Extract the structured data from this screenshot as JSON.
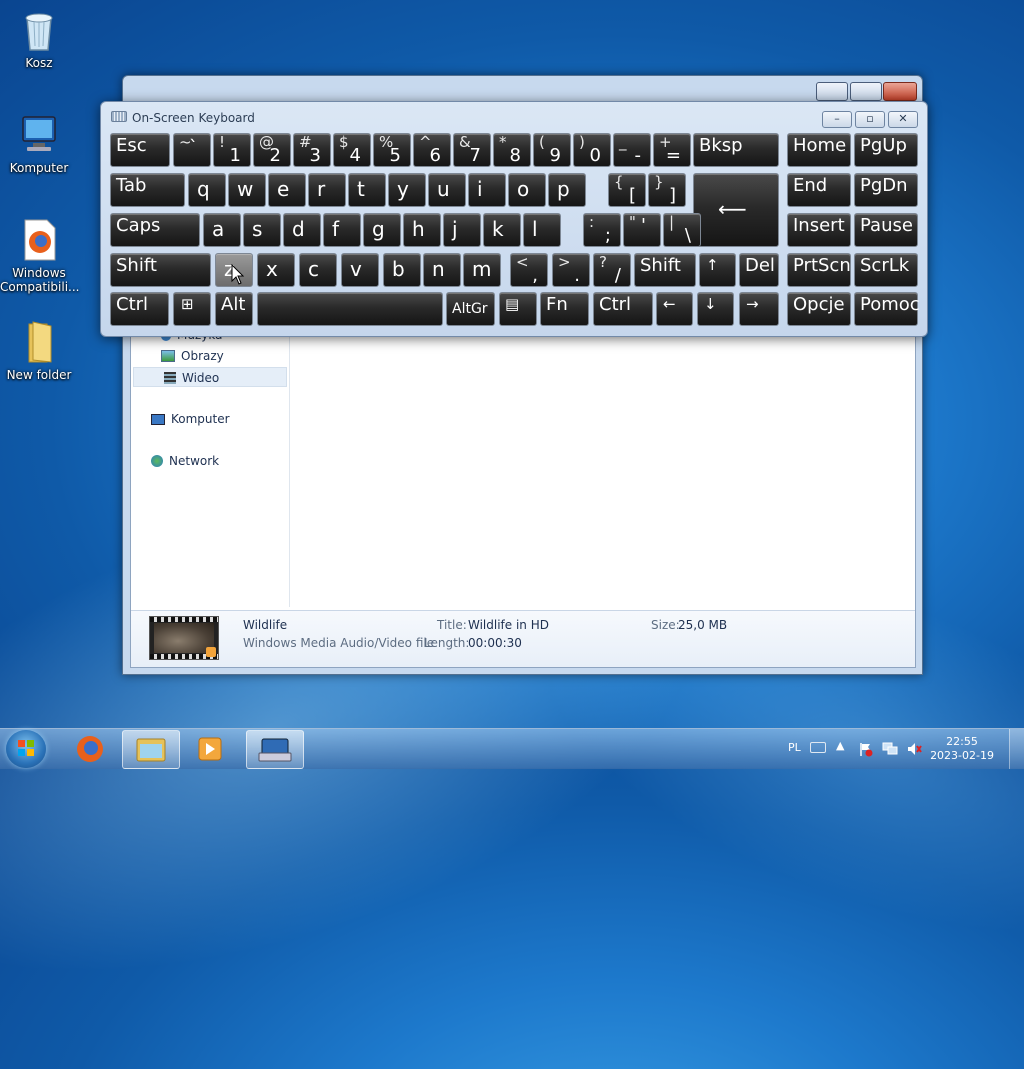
{
  "desktop": {
    "icons": [
      {
        "label": "Kosz"
      },
      {
        "label": "Komputer"
      },
      {
        "label": "Windows Compatibili..."
      },
      {
        "label": "New folder"
      }
    ]
  },
  "explorer": {
    "nav": {
      "muzyka": "Muzyka",
      "obrazy": "Obrazy",
      "wideo": "Wideo",
      "komputer": "Komputer",
      "network": "Network"
    },
    "details": {
      "name": "Wildlife",
      "type": "Windows Media Audio/Video file",
      "title_label": "Title:",
      "title_value": "Wildlife in HD",
      "length_label": "Length:",
      "length_value": "00:00:30",
      "size_label": "Size:",
      "size_value": "25,0 MB"
    }
  },
  "osk": {
    "title": "On-Screen Keyboard",
    "keys": {
      "esc": "Esc",
      "bksp": "Bksp",
      "home": "Home",
      "pgup": "PgUp",
      "tab": "Tab",
      "end": "End",
      "pgdn": "PgDn",
      "caps": "Caps",
      "insert": "Insert",
      "pause": "Pause",
      "shift_l": "Shift",
      "shift_r": "Shift",
      "del": "Del",
      "prtscn": "PrtScn",
      "scrlk": "ScrLk",
      "ctrl_l": "Ctrl",
      "alt": "Alt",
      "altgr": "AltGr",
      "fn": "Fn",
      "ctrl_r": "Ctrl",
      "opcje": "Opcje",
      "pomoc": "Pomoc",
      "enter": "⟵",
      "up": "↑",
      "left": "←",
      "down": "↓",
      "right": "→",
      "menu": "▤",
      "win": "⊞",
      "num": [
        {
          "top": "~",
          "bot": "`"
        },
        {
          "top": "!",
          "bot": "1"
        },
        {
          "top": "@",
          "bot": "2"
        },
        {
          "top": "#",
          "bot": "3"
        },
        {
          "top": "$",
          "bot": "4"
        },
        {
          "top": "%",
          "bot": "5"
        },
        {
          "top": "^",
          "bot": "6"
        },
        {
          "top": "&",
          "bot": "7"
        },
        {
          "top": "*",
          "bot": "8"
        },
        {
          "top": "(",
          "bot": "9"
        },
        {
          "top": ")",
          "bot": "0"
        },
        {
          "top": "_",
          "bot": "-"
        },
        {
          "top": "+",
          "bot": "="
        }
      ],
      "row_q": [
        "q",
        "w",
        "e",
        "r",
        "t",
        "y",
        "u",
        "i",
        "o",
        "p"
      ],
      "bracket_l": {
        "top": "{",
        "bot": "["
      },
      "bracket_r": {
        "top": "}",
        "bot": "]"
      },
      "row_a": [
        "a",
        "s",
        "d",
        "f",
        "g",
        "h",
        "j",
        "k",
        "l"
      ],
      "semicolon": {
        "top": ":",
        "bot": ";"
      },
      "quote": {
        "top": "\"",
        "bot": "'"
      },
      "backslash": {
        "top": "|",
        "bot": "\\"
      },
      "row_z": [
        "z",
        "x",
        "c",
        "v",
        "b",
        "n",
        "m"
      ],
      "comma": {
        "top": "<",
        "bot": ","
      },
      "period": {
        "top": ">",
        "bot": "."
      },
      "slash": {
        "top": "?",
        "bot": "/"
      }
    }
  },
  "taskbar": {
    "lang": "PL",
    "time": "22:55",
    "date": "2023-02-19"
  }
}
